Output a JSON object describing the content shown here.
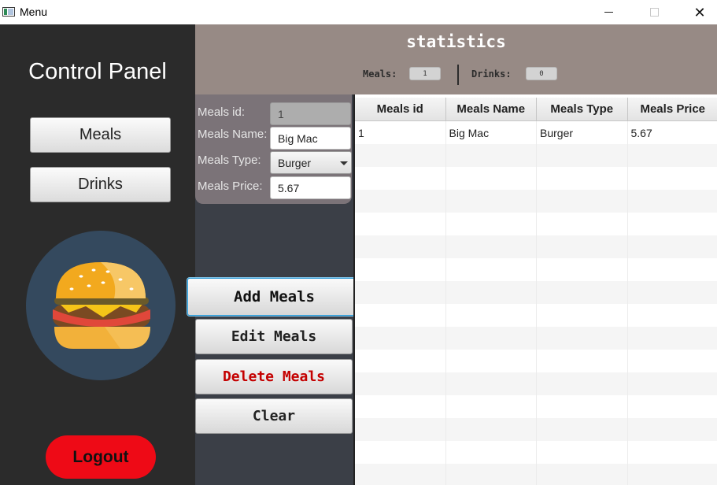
{
  "window": {
    "title": "Menu",
    "icon": "app-window-icon"
  },
  "sidebar": {
    "title": "Control Panel",
    "buttons": {
      "meals": "Meals",
      "drinks": "Drinks"
    },
    "logout": "Logout",
    "image": "burger-illustration"
  },
  "stats": {
    "title": "statistics",
    "meals_label": "Meals:",
    "meals_value": "1",
    "drinks_label": "Drinks:",
    "drinks_value": "0"
  },
  "form": {
    "id_label": "Meals id:",
    "id_value": "1",
    "name_label": "Meals Name:",
    "name_value": "Big Mac",
    "type_label": "Meals Type:",
    "type_value": "Burger",
    "price_label": "Meals Price:",
    "price_value": "5.67"
  },
  "actions": {
    "add": "Add Meals",
    "edit": "Edit Meals",
    "delete": "Delete Meals",
    "clear": "Clear"
  },
  "table": {
    "columns": [
      "Meals id",
      "Meals Name",
      "Meals Type",
      "Meals Price"
    ],
    "rows": [
      [
        "1",
        "Big Mac",
        "Burger",
        "5.67"
      ]
    ]
  },
  "colors": {
    "sidebar_bg": "#2b2b2b",
    "stats_bg": "#978a85",
    "logout_red": "#ee0a16",
    "delete_text": "#c40000",
    "focus_blue": "#2c9ad6"
  }
}
